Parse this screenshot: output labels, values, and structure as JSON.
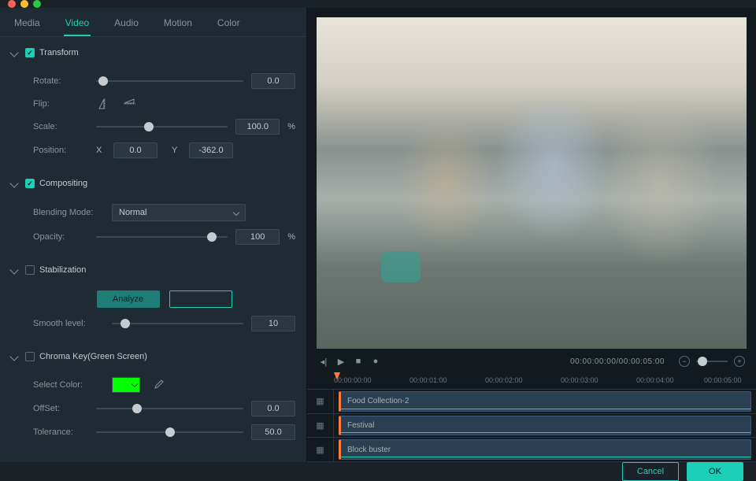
{
  "tabs": [
    "Media",
    "Video",
    "Audio",
    "Motion",
    "Color"
  ],
  "active_tab": 1,
  "transform": {
    "title": "Transform",
    "checked": true,
    "rotate": {
      "label": "Rotate:",
      "value": "0.0",
      "pos": 5
    },
    "flip": {
      "label": "Flip:"
    },
    "scale": {
      "label": "Scale:",
      "value": "100.0",
      "unit": "%",
      "pos": 40
    },
    "position": {
      "label": "Position:",
      "x_label": "X",
      "x": "0.0",
      "y_label": "Y",
      "y": "-362.0"
    }
  },
  "compositing": {
    "title": "Compositing",
    "checked": true,
    "blending": {
      "label": "Blending Mode:",
      "value": "Normal"
    },
    "opacity": {
      "label": "Opacity:",
      "value": "100",
      "unit": "%",
      "pos": 88
    }
  },
  "stabilization": {
    "title": "Stabilization",
    "checked": false,
    "analyze_label": "Analyze",
    "smooth": {
      "label": "Smooth level:",
      "value": "10",
      "pos": 10
    }
  },
  "chroma": {
    "title": "Chroma Key(Green Screen)",
    "checked": false,
    "select_color_label": "Select Color:",
    "color": "#00ff00",
    "offset": {
      "label": "OffSet:",
      "value": "0.0",
      "pos": 28
    },
    "tolerance": {
      "label": "Tolerance:",
      "value": "50.0",
      "pos": 50
    }
  },
  "transport": {
    "timecode": "00:00:00:00/00:00:05:00"
  },
  "ruler": [
    "00:00:00:00",
    "00:00:01:00",
    "00:00:02:00",
    "00:00:03:00",
    "00:00:04:00",
    "00:00:05:00"
  ],
  "tracks": [
    {
      "name": "Food Collection-2"
    },
    {
      "name": "Festival"
    },
    {
      "name": "Block buster"
    }
  ],
  "footer": {
    "cancel": "Cancel",
    "ok": "OK"
  }
}
